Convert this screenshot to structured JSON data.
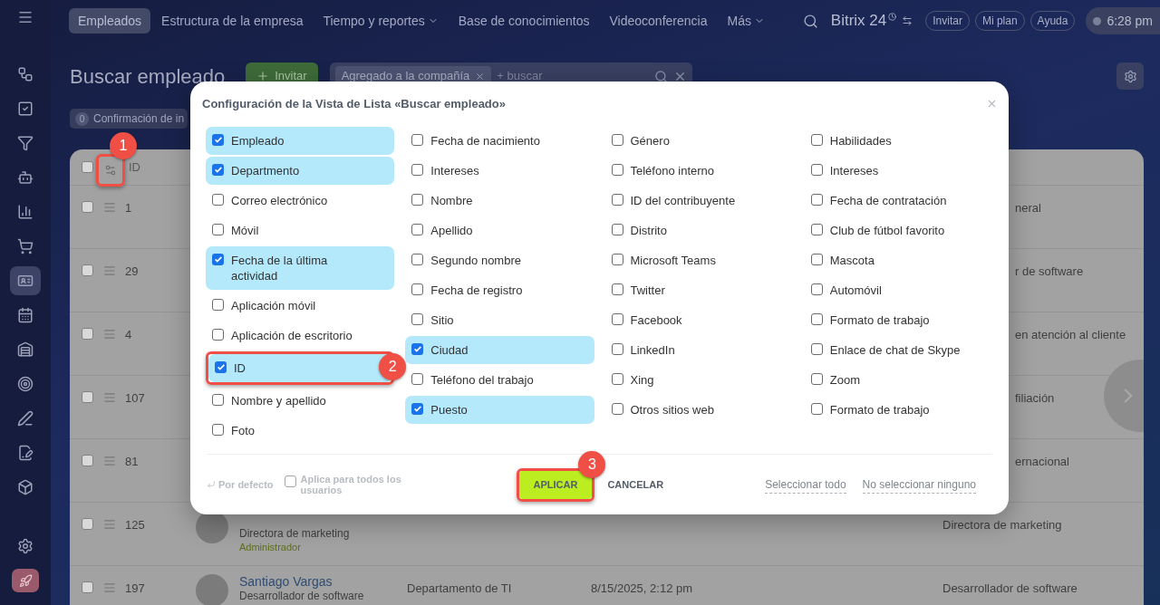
{
  "sidebar": {
    "items": [
      {
        "selected": false
      },
      {
        "selected": false
      },
      {
        "selected": false
      },
      {
        "selected": false
      },
      {
        "selected": false
      },
      {
        "selected": false
      },
      {
        "selected": true
      },
      {
        "selected": false
      },
      {
        "selected": false
      },
      {
        "selected": false
      },
      {
        "selected": false
      },
      {
        "selected": false
      },
      {
        "selected": false
      }
    ]
  },
  "nav": {
    "tabs": [
      {
        "label": "Empleados",
        "selected": true,
        "dropdown": false
      },
      {
        "label": "Estructura de la empresa",
        "selected": false,
        "dropdown": false
      },
      {
        "label": "Tiempo y reportes",
        "selected": false,
        "dropdown": true
      },
      {
        "label": "Base de conocimientos",
        "selected": false,
        "dropdown": false
      },
      {
        "label": "Videoconferencia",
        "selected": false,
        "dropdown": false
      },
      {
        "label": "Más",
        "selected": false,
        "dropdown": true
      }
    ],
    "logo": "Bitrix 24",
    "buttons": [
      "Invitar",
      "Mi plan",
      "Ayuda"
    ],
    "clock": "6:28 pm"
  },
  "page": {
    "title": "Buscar empleado",
    "invite": "Invitar",
    "search": {
      "tag": "Agregado a la compañía",
      "placeholder": "+ buscar"
    },
    "filter_chip": {
      "count": "0",
      "label": "Confirmación de in"
    }
  },
  "table": {
    "all_checked": false,
    "id_header": "ID",
    "settings_callout": "1",
    "rows": [
      {
        "id": "1",
        "checked": false,
        "position_fragment": "neral"
      },
      {
        "id": "29",
        "checked": false,
        "position_fragment": "r de software"
      },
      {
        "id": "4",
        "checked": false,
        "position_fragment": "en atención al cliente"
      },
      {
        "id": "107",
        "checked": false,
        "position_fragment": "filiación"
      },
      {
        "id": "81",
        "checked": false,
        "position_fragment": "ernacional"
      },
      {
        "id": "125",
        "checked": false,
        "title": "Directora de marketing",
        "role": "Administrador",
        "position": "Directora de marketing"
      },
      {
        "id": "197",
        "checked": false,
        "name": "Santiago Vargas",
        "title": "Desarrollador de software",
        "department": "Departamento de TI",
        "activity": "8/15/2025, 2:12 pm",
        "position": "Desarrollador de software"
      }
    ]
  },
  "dialog": {
    "title": "Configuración de la Vista de Lista «Buscar empleado»",
    "columns": [
      [
        {
          "label": "Empleado",
          "checked": true
        },
        {
          "label": "Departmento",
          "checked": true
        },
        {
          "label": "Correo electrónico",
          "checked": false
        },
        {
          "label": "Móvil",
          "checked": false
        },
        {
          "label": "Fecha de la última actividad",
          "checked": true
        },
        {
          "label": "Aplicación móvil",
          "checked": false
        },
        {
          "label": "Aplicación de escritorio",
          "checked": false
        },
        {
          "label": "ID",
          "checked": true,
          "callout": "2"
        },
        {
          "label": "Nombre y apellido",
          "checked": false
        },
        {
          "label": "Foto",
          "checked": false
        }
      ],
      [
        {
          "label": "Fecha de nacimiento",
          "checked": false
        },
        {
          "label": "Intereses",
          "checked": false
        },
        {
          "label": "Nombre",
          "checked": false
        },
        {
          "label": "Apellido",
          "checked": false
        },
        {
          "label": "Segundo nombre",
          "checked": false
        },
        {
          "label": "Fecha de registro",
          "checked": false
        },
        {
          "label": "Sitio",
          "checked": false
        },
        {
          "label": "Ciudad",
          "checked": true
        },
        {
          "label": "Teléfono del trabajo",
          "checked": false
        },
        {
          "label": "Puesto",
          "checked": true
        }
      ],
      [
        {
          "label": "Género",
          "checked": false
        },
        {
          "label": "Teléfono interno",
          "checked": false
        },
        {
          "label": "ID del contribuyente",
          "checked": false
        },
        {
          "label": "Distrito",
          "checked": false
        },
        {
          "label": "Microsoft Teams",
          "checked": false
        },
        {
          "label": "Twitter",
          "checked": false
        },
        {
          "label": "Facebook",
          "checked": false
        },
        {
          "label": "LinkedIn",
          "checked": false
        },
        {
          "label": "Xing",
          "checked": false
        },
        {
          "label": "Otros sitios web",
          "checked": false
        }
      ],
      [
        {
          "label": "Habilidades",
          "checked": false
        },
        {
          "label": "Intereses",
          "checked": false
        },
        {
          "label": "Fecha de contratación",
          "checked": false
        },
        {
          "label": "Club de fútbol favorito",
          "checked": false
        },
        {
          "label": "Mascota",
          "checked": false
        },
        {
          "label": "Automóvil",
          "checked": false
        },
        {
          "label": "Formato de trabajo",
          "checked": false
        },
        {
          "label": "Enlace de chat de Skype",
          "checked": false
        },
        {
          "label": "Zoom",
          "checked": false
        },
        {
          "label": "Formato de trabajo",
          "checked": false
        }
      ]
    ],
    "reset": "Por defecto",
    "all_users": {
      "label": "Aplica para todos los usuarios",
      "checked": false
    },
    "apply": "APLICAR",
    "apply_callout": "3",
    "cancel": "CANCELAR",
    "select_all": "Seleccionar todo",
    "select_none": "No seleccionar ninguno"
  }
}
